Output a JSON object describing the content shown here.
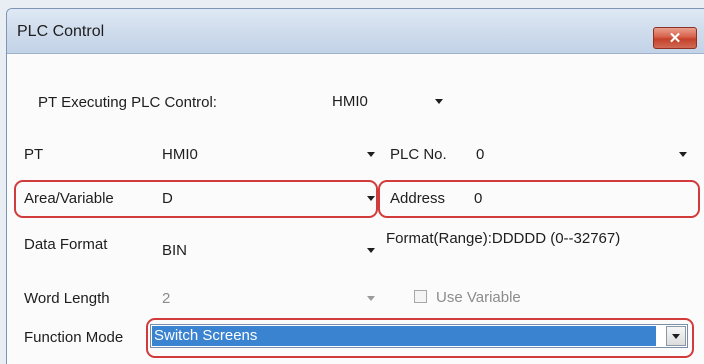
{
  "window": {
    "title": "PLC Control",
    "close_glyph": "✕"
  },
  "pt_executing": {
    "label": "PT Executing PLC Control:",
    "value": "HMI0"
  },
  "pt": {
    "label": "PT",
    "value": "HMI0"
  },
  "plc_no": {
    "label": "PLC No.",
    "value": "0"
  },
  "area_variable": {
    "label": "Area/Variable",
    "value": "D"
  },
  "address": {
    "label": "Address",
    "value": "0"
  },
  "data_format": {
    "label": "Data  Format",
    "value": "BIN"
  },
  "format_range": {
    "text": "Format(Range):DDDDD (0--32767)"
  },
  "word_length": {
    "label": "Word Length",
    "value": "2"
  },
  "use_variable": {
    "label": "Use Variable",
    "checked": false
  },
  "function_mode": {
    "label": "Function Mode",
    "value": "Switch Screens"
  },
  "highlight_color": "#d23b3b",
  "selection_color": "#3a83d1"
}
